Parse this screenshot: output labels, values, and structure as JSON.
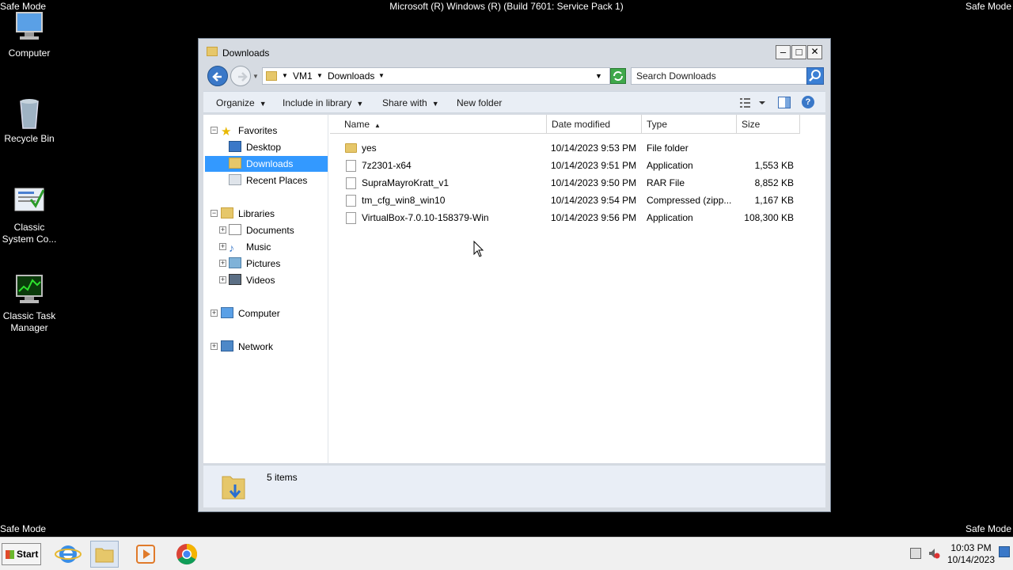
{
  "desktop": {
    "safe_mode_label": "Safe Mode",
    "build_text": "Microsoft (R) Windows (R) (Build 7601: Service Pack 1)",
    "icons": [
      {
        "label": "Computer",
        "icon": "computer-icon"
      },
      {
        "label": "Recycle Bin",
        "icon": "recycle-bin-icon"
      },
      {
        "label": "Classic System Co...",
        "icon": "system-config-icon"
      },
      {
        "label": "Classic Task Manager",
        "icon": "task-manager-icon"
      }
    ]
  },
  "window": {
    "title": "Downloads",
    "controls": {
      "minimize": "–",
      "maximize": "□",
      "close": "✕"
    },
    "address": {
      "segments": [
        "VM1",
        "Downloads"
      ]
    },
    "search": {
      "placeholder": "Search Downloads"
    },
    "toolbar": {
      "organize": "Organize",
      "include_in_library": "Include in library",
      "share_with": "Share with",
      "new_folder": "New folder"
    },
    "nav": {
      "favorites": "Favorites",
      "desktop": "Desktop",
      "downloads": "Downloads",
      "recent_places": "Recent Places",
      "libraries": "Libraries",
      "documents": "Documents",
      "music": "Music",
      "pictures": "Pictures",
      "videos": "Videos",
      "computer": "Computer",
      "network": "Network"
    },
    "columns": {
      "name": "Name",
      "date_modified": "Date modified",
      "type": "Type",
      "size": "Size"
    },
    "files": [
      {
        "name": "yes",
        "date": "10/14/2023 9:53 PM",
        "type": "File folder",
        "size": "",
        "kind": "folder"
      },
      {
        "name": "7z2301-x64",
        "date": "10/14/2023 9:51 PM",
        "type": "Application",
        "size": "1,553 KB",
        "kind": "file"
      },
      {
        "name": "SupraMayroKratt_v1",
        "date": "10/14/2023 9:50 PM",
        "type": "RAR File",
        "size": "8,852 KB",
        "kind": "file"
      },
      {
        "name": "tm_cfg_win8_win10",
        "date": "10/14/2023 9:54 PM",
        "type": "Compressed (zipp...",
        "size": "1,167 KB",
        "kind": "file"
      },
      {
        "name": "VirtualBox-7.0.10-158379-Win",
        "date": "10/14/2023 9:56 PM",
        "type": "Application",
        "size": "108,300 KB",
        "kind": "file"
      }
    ],
    "status": {
      "items_count": "5 items"
    }
  },
  "taskbar": {
    "start_label": "Start",
    "clock_time": "10:03 PM",
    "clock_date": "10/14/2023"
  },
  "colors": {
    "selection": "#3399ff",
    "desktop_bg": "#000000",
    "accent": "#3b7fd4"
  }
}
